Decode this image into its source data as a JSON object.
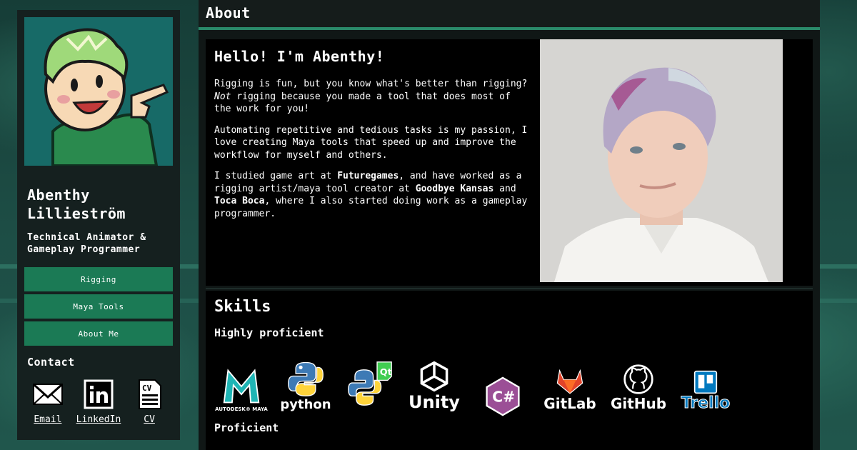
{
  "sidebar": {
    "name_line1": "Abenthy",
    "name_line2": "Lillieström",
    "role_line1": "Technical Animator &",
    "role_line2": "Gameplay Programmer",
    "nav": [
      "Rigging",
      "Maya Tools",
      "About Me"
    ],
    "contact_title": "Contact",
    "contacts": [
      {
        "label": "Email",
        "icon": "envelope-icon"
      },
      {
        "label": "LinkedIn",
        "icon": "linkedin-icon"
      },
      {
        "label": "CV",
        "icon": "cv-document-icon",
        "icon_text": "CV"
      }
    ]
  },
  "main": {
    "header": "About",
    "hello": "Hello! I'm Abenthy!",
    "para1_a": "Rigging is fun, but you know what's better than rigging? ",
    "para1_em": "Not",
    "para1_b": " rigging because you made a tool that does most of the work for you!",
    "para2": "Automating repetitive and tedious tasks is my passion, I love creating Maya tools that speed up and improve the workflow for myself and others.",
    "para3_a": "I studied game art at ",
    "para3_b1": "Futuregames",
    "para3_c": ", and have worked as a rigging artist/maya tool creator at ",
    "para3_b2": "Goodbye Kansas",
    "para3_d": " and ",
    "para3_b3": "Toca Boca",
    "para3_e": ", where I also started doing work as a gameplay programmer.",
    "skills_title": "Skills",
    "highly_proficient": "Highly proficient",
    "proficient": "Proficient",
    "logos": [
      {
        "icon": "maya-logo-icon",
        "text": "AUTODESK® MAYA",
        "color": "#1fb5b5"
      },
      {
        "icon": "python-logo-icon",
        "text": "python",
        "color": "#3d7ab5"
      },
      {
        "icon": "pyqt-logo-icon",
        "text": "Qt",
        "color": "#41cd52"
      },
      {
        "icon": "unity-logo-icon",
        "text": "Unity",
        "color": "#ffffff"
      },
      {
        "icon": "csharp-logo-icon",
        "text": "C#",
        "color": "#9b4f96"
      },
      {
        "icon": "gitlab-logo-icon",
        "text": "GitLab",
        "color": "#e24329"
      },
      {
        "icon": "github-logo-icon",
        "text": "GitHub",
        "color": "#ffffff"
      },
      {
        "icon": "trello-logo-icon",
        "text": "Trello",
        "color": "#0079bf"
      }
    ]
  },
  "colors": {
    "accent": "#1b7a55",
    "panel": "#15201f",
    "background": "#1b4a42"
  }
}
